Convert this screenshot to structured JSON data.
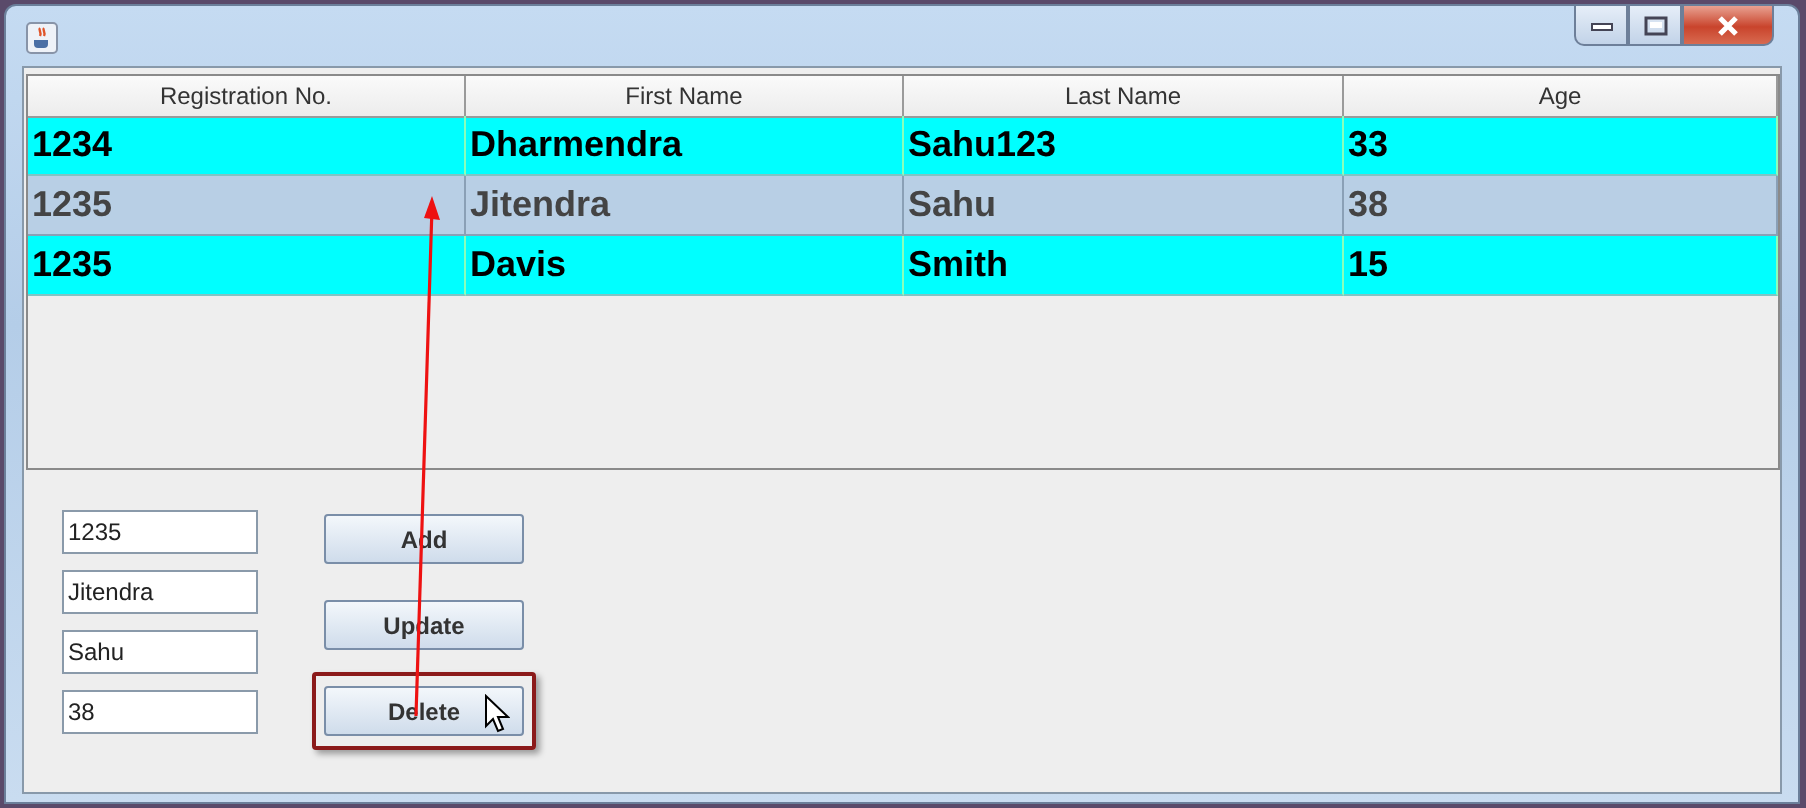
{
  "table": {
    "columns": [
      "Registration No.",
      "First Name",
      "Last Name",
      "Age"
    ],
    "rows": [
      {
        "cells": [
          "1234",
          "Dharmendra",
          "Sahu123",
          "33"
        ],
        "selected": false
      },
      {
        "cells": [
          "1235",
          "Jitendra",
          "Sahu",
          "38"
        ],
        "selected": true
      },
      {
        "cells": [
          "1235",
          "Davis",
          "Smith",
          "15"
        ],
        "selected": false
      }
    ]
  },
  "fields": [
    {
      "value": "1235"
    },
    {
      "value": "Jitendra"
    },
    {
      "value": "Sahu"
    },
    {
      "value": "38"
    }
  ],
  "buttons": [
    {
      "label": "Add",
      "highlighted": false
    },
    {
      "label": "Update",
      "highlighted": false
    },
    {
      "label": "Delete",
      "highlighted": true
    }
  ]
}
